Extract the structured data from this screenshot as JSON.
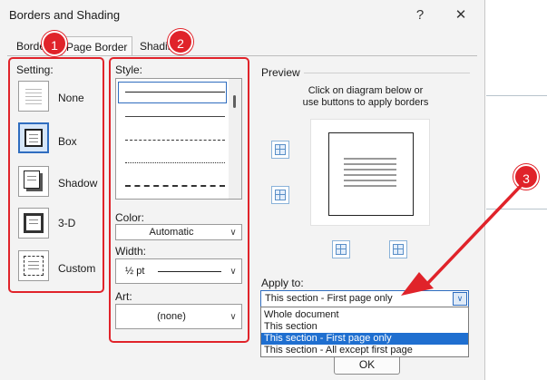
{
  "dialog": {
    "title": "Borders and Shading",
    "help_label": "?",
    "close_label": "✕"
  },
  "tabs": [
    {
      "label": "Borders"
    },
    {
      "label": "Page Border"
    },
    {
      "label": "Shading"
    }
  ],
  "setting": {
    "label": "Setting:",
    "items": [
      {
        "label": "None"
      },
      {
        "label": "Box"
      },
      {
        "label": "Shadow"
      },
      {
        "label": "3-D"
      },
      {
        "label": "Custom"
      }
    ]
  },
  "style": {
    "label": "Style:"
  },
  "color": {
    "label": "Color:",
    "value": "Automatic"
  },
  "width": {
    "label": "Width:",
    "value": "½ pt"
  },
  "art": {
    "label": "Art:",
    "value": "(none)"
  },
  "preview": {
    "label": "Preview",
    "hint_line1": "Click on diagram below or",
    "hint_line2": "use buttons to apply borders"
  },
  "apply_to": {
    "label": "Apply to:",
    "value": "This section - First page only",
    "options": [
      {
        "label": "Whole document"
      },
      {
        "label": "This section"
      },
      {
        "label": "This section - First page only"
      },
      {
        "label": "This section - All except first page"
      }
    ]
  },
  "ok_label": "OK",
  "annotations": {
    "badge1": "1",
    "badge2": "2",
    "badge3": "3"
  },
  "colors": {
    "annotation_red": "#e0232a",
    "selection_blue": "#1f6fd0"
  }
}
